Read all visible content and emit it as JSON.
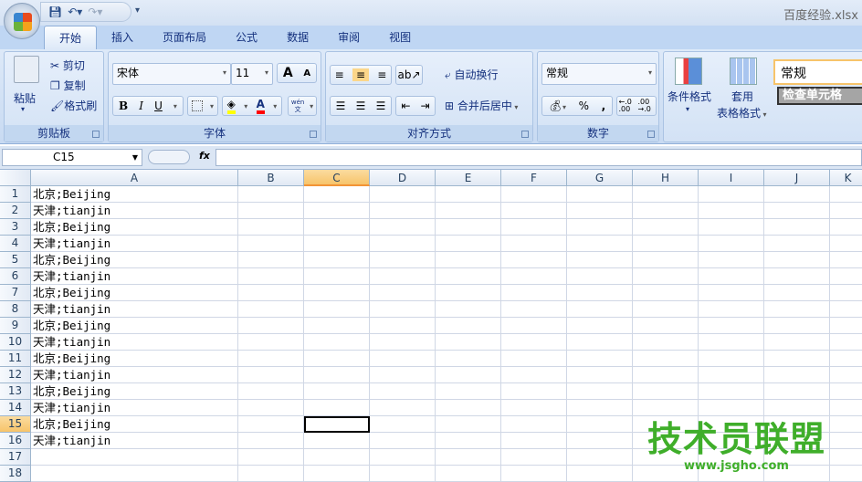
{
  "window": {
    "title": "百度经验.xlsx"
  },
  "tabs": [
    "开始",
    "插入",
    "页面布局",
    "公式",
    "数据",
    "审阅",
    "视图"
  ],
  "clipboard": {
    "paste": "粘贴",
    "cut": "剪切",
    "copy": "复制",
    "format_painter": "格式刷",
    "label": "剪贴板"
  },
  "font": {
    "name": "宋体",
    "size": "11",
    "grow": "A",
    "shrink": "A",
    "bold": "B",
    "italic": "I",
    "underline": "U",
    "color_glyph": "A",
    "phonetic": "wén\n文",
    "label": "字体",
    "fill_color": "#ffff00",
    "font_color": "#ff0000"
  },
  "alignment": {
    "wrap": "自动换行",
    "merge": "合并后居中",
    "label": "对齐方式"
  },
  "number": {
    "format": "常规",
    "percent": "%",
    "comma": ",",
    "inc_decimal": "←.0 .00",
    "dec_decimal": ".00 →.0",
    "label": "数字"
  },
  "styles": {
    "conditional": "条件格式",
    "table_line1": "套用",
    "table_line2": "表格格式",
    "style_normal": "常规",
    "style_check": "检查单元格"
  },
  "formula_bar": {
    "name_box": "C15",
    "fx": "fx",
    "formula": ""
  },
  "columns": [
    "A",
    "B",
    "C",
    "D",
    "E",
    "F",
    "G",
    "H",
    "I",
    "J",
    "K"
  ],
  "selected_column": "C",
  "selected_row": 15,
  "rows": [
    {
      "n": "1",
      "a": "北京;Beijing"
    },
    {
      "n": "2",
      "a": "天津;tianjin"
    },
    {
      "n": "3",
      "a": "北京;Beijing"
    },
    {
      "n": "4",
      "a": "天津;tianjin"
    },
    {
      "n": "5",
      "a": "北京;Beijing"
    },
    {
      "n": "6",
      "a": "天津;tianjin"
    },
    {
      "n": "7",
      "a": "北京;Beijing"
    },
    {
      "n": "8",
      "a": "天津;tianjin"
    },
    {
      "n": "9",
      "a": "北京;Beijing"
    },
    {
      "n": "10",
      "a": "天津;tianjin"
    },
    {
      "n": "11",
      "a": "北京;Beijing"
    },
    {
      "n": "12",
      "a": "天津;tianjin"
    },
    {
      "n": "13",
      "a": "北京;Beijing"
    },
    {
      "n": "14",
      "a": "天津;tianjin"
    },
    {
      "n": "15",
      "a": "北京;Beijing"
    },
    {
      "n": "16",
      "a": "天津;tianjin"
    },
    {
      "n": "17",
      "a": ""
    },
    {
      "n": "18",
      "a": ""
    }
  ],
  "watermark": {
    "title": "技术员联盟",
    "url": "www.jsgho.com"
  }
}
